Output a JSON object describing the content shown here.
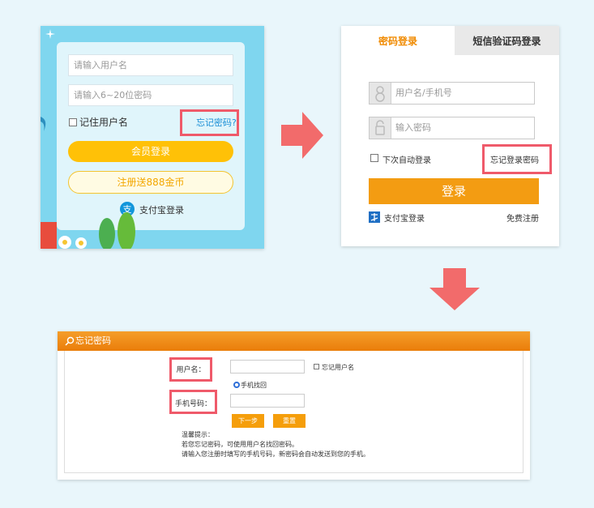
{
  "panel1": {
    "username_placeholder": "请输入用户名",
    "password_placeholder": "请输入6~20位密码",
    "remember_label": "记住用户名",
    "forgot_link": "忘记密码?",
    "login_button": "会员登录",
    "register_button": "注册送888金币",
    "alipay_label": "支付宝登录"
  },
  "panel2": {
    "tabs": [
      {
        "label": "密码登录",
        "active": true
      },
      {
        "label": "短信验证码登录",
        "active": false
      }
    ],
    "username_placeholder": "用户名/手机号",
    "password_placeholder": "输入密码",
    "auto_login_label": "下次自动登录",
    "forgot_link": "忘记登录密码",
    "login_button": "登录",
    "alipay_label": "支付宝登录",
    "register_link": "免费注册"
  },
  "panel3": {
    "title": "忘记密码",
    "username_label": "用户名：",
    "forgot_username_label": "忘记用户名",
    "phone_recovery_label": "手机找回",
    "phone_label": "手机号码：",
    "next_button": "下一步",
    "reset_button": "重置",
    "tips_title": "温馨提示：",
    "tips_line1": "若您忘记密码，可使用用户名找回密码。",
    "tips_line2": "请输入您注册时填写的手机号码，新密码会自动发送到您的手机。"
  },
  "colors": {
    "highlight_red": "#ef5a6a",
    "arrow_color": "#f26b6b",
    "accent_orange": "#f39c12",
    "login_yellow": "#ffc107",
    "tab_active_orange": "#f08a00"
  }
}
